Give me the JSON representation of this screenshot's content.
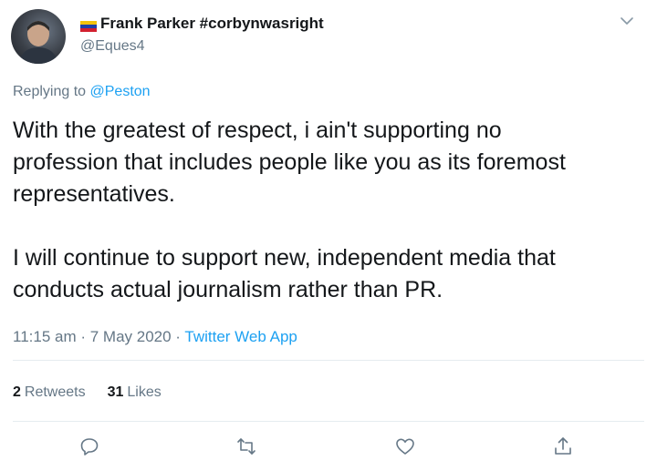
{
  "author": {
    "name": "Frank Parker #corbynwasright",
    "handle": "@Eques4"
  },
  "reply": {
    "prefix": "Replying to ",
    "to": "@Peston"
  },
  "tweet": {
    "text": "With the greatest of respect, i ain't supporting no\nprofession that includes people like you as its foremost\nrepresentatives.\n\nI will continue to support new, independent media that\nconducts actual journalism rather than PR."
  },
  "meta": {
    "time": "11:15 am",
    "sep1": " · ",
    "date": "7 May 2020",
    "sep2": " · ",
    "app": "Twitter Web App"
  },
  "stats": {
    "retweets_count": "2",
    "retweets_label": "Retweets",
    "likes_count": "31",
    "likes_label": "Likes"
  },
  "colors": {
    "accent": "#1da1f2",
    "secondary_text": "#657786",
    "primary_text": "#14171a",
    "divider": "#e6ecf0"
  },
  "icons": [
    "chevron-down-icon",
    "reply-icon",
    "retweet-icon",
    "like-icon",
    "share-icon",
    "venezuela-flag-icon"
  ]
}
